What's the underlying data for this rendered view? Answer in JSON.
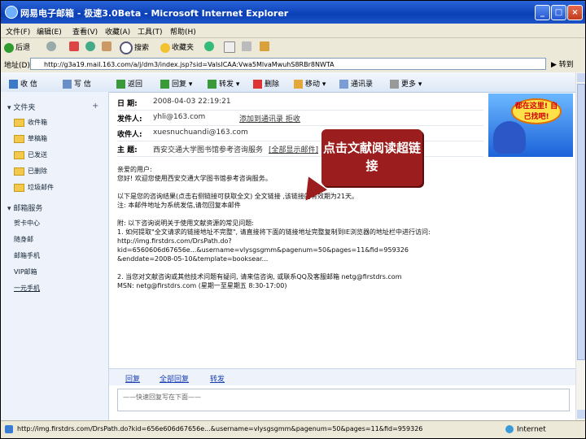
{
  "window": {
    "title": "网易电子邮箱 - 极速3.0Beta - Microsoft Internet Explorer",
    "buttons": [
      "_",
      "□",
      "×"
    ]
  },
  "menu": [
    "文件(F)",
    "编辑(E)",
    "查看(V)",
    "收藏(A)",
    "工具(T)",
    "帮助(H)"
  ],
  "toolbar": {
    "back": "后退",
    "search": "搜索",
    "favorites": "收藏夹"
  },
  "address": {
    "label": "地址(D)",
    "url": "http://g3a19.mail.163.com/a/j/dm3/index.jsp?sid=VaIsICAA:Vwa5MlvaMwuhS8RBr8NWTA",
    "go": "转到"
  },
  "nav": {
    "inbox": "收 信",
    "compose": "写 信",
    "back": "返回",
    "reply": "回复",
    "forward": "转发",
    "delete": "删除",
    "move": "移动",
    "contacts": "通讯录",
    "more": "更多"
  },
  "sidebar": {
    "folders_header": "文件夹",
    "folders": [
      "收件箱",
      "草稿箱",
      "已发送",
      "已删除",
      "垃圾邮件"
    ],
    "services_header": "邮箱服务",
    "services": [
      "贺卡中心",
      "随身邮",
      "邮箱手机",
      "VIP邮箱",
      "一元手机"
    ]
  },
  "message": {
    "date_label": "日 期:",
    "date": "2008-04-03 22:19:21",
    "from_label": "发件人:",
    "from": "yhli@163.com",
    "from_actions": "添加到通讯录  拒收",
    "to_label": "收件人:",
    "to": "xuesnuchuandi@163.com",
    "subject_label": "主 题:",
    "subject": "西安交通大学图书馆参考咨询服务",
    "subject_action": "[全部显示邮件]"
  },
  "ad": {
    "text": "都在这里! 自己找吧!"
  },
  "body_lines": [
    "亲爱的用户:",
    "您好! 欢迎您使用西安交通大学图书馆参考咨询服务。",
    "",
    "以下是您的咨询结果(点击右侧链接可获取全文) 全文链接 ,该链接的有效期为21天。",
    "注: 本邮件地址为系统发信,请勿回复本邮件",
    "",
    "附: 以下咨询说明关于使用文献资源的常见问题:",
    "1. 如何提取\"全文请求的链接地址不完整\", 请直接将下面的链接地址完整复制到IE浏览器的地址栏中进行访问:",
    "http://img.firstdrs.com/DrsPath.do?",
    "kid=6560606d67656e...&username=vlysgsgmm&pagenum=50&pages=11&fid=959326",
    "&enddate=2008-05-10&template=booksear...",
    "",
    "2. 当您对文献咨询或其他技术问题有疑问, 请来信咨询, 或联系QQ及客服邮箱 netg@firstdrs.com",
    "MSN: netg@firstdrs.com (星期一至星期五 8:30-17:00)"
  ],
  "reply_bar": [
    "回复",
    "全部回复",
    "转发"
  ],
  "quick_reply": "——快速回复写在下面——",
  "callout": "点击文献阅读超链接",
  "status": {
    "url": "http://img.firstdrs.com/DrsPath.do?kid=656e606d67656e...&username=vlysgsgmm&pagenum=50&pages=11&fid=959326",
    "zone": "Internet"
  }
}
